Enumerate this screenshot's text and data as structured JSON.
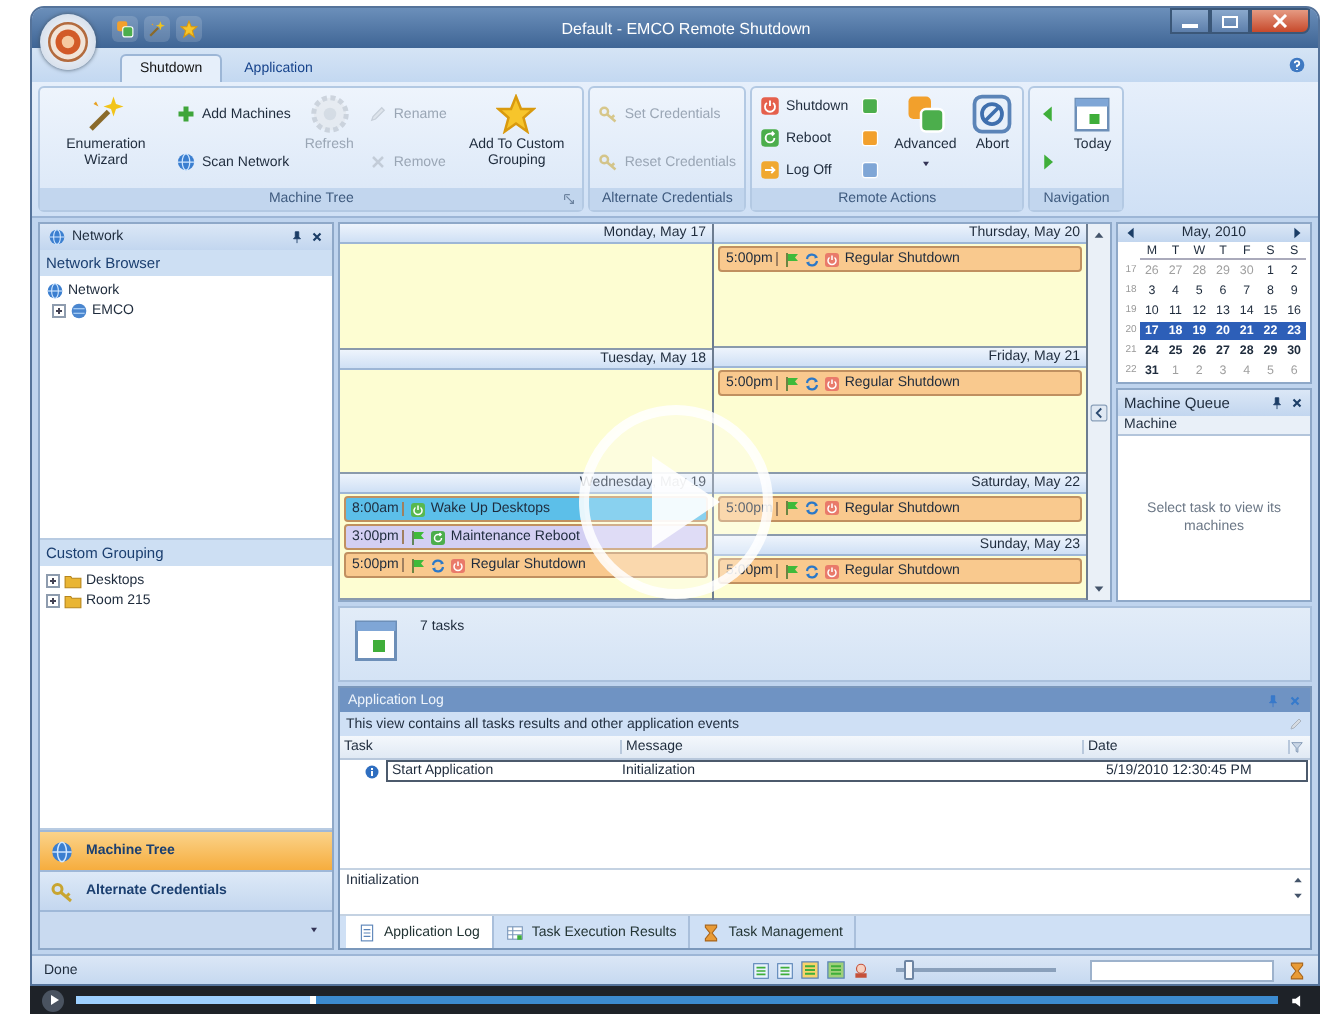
{
  "window": {
    "title": "Default - EMCO Remote Shutdown"
  },
  "ribbon": {
    "tabs": [
      {
        "label": "Shutdown",
        "selected": true
      },
      {
        "label": "Application",
        "selected": false
      }
    ],
    "groups": [
      {
        "label": "Machine Tree",
        "columns": [
          {
            "kind": "large",
            "items": [
              {
                "label": "Enumeration Wizard",
                "disabled": false
              }
            ]
          },
          {
            "kind": "stack",
            "items": [
              {
                "label": "Add Machines",
                "disabled": false
              },
              {
                "label": "Scan Network",
                "disabled": false
              }
            ]
          },
          {
            "kind": "large",
            "items": [
              {
                "label": "Refresh",
                "disabled": true
              }
            ]
          },
          {
            "kind": "stack",
            "items": [
              {
                "label": "Rename",
                "disabled": true
              },
              {
                "label": "Remove",
                "disabled": true
              }
            ]
          },
          {
            "kind": "large",
            "items": [
              {
                "label": "Add To Custom Grouping",
                "disabled": false
              }
            ]
          }
        ]
      },
      {
        "label": "Alternate Credentials",
        "columns": [
          {
            "kind": "stack",
            "items": [
              {
                "label": "Set Credentials",
                "disabled": true
              },
              {
                "label": "Reset Credentials",
                "disabled": true
              }
            ]
          }
        ]
      },
      {
        "label": "Remote Actions",
        "columns": [
          {
            "kind": "stack",
            "items": [
              {
                "label": "Shutdown",
                "disabled": false
              },
              {
                "label": "Reboot",
                "disabled": false
              },
              {
                "label": "Log Off",
                "disabled": false
              }
            ]
          },
          {
            "kind": "stack",
            "items": [
              {
                "disabled": false
              },
              {
                "disabled": false
              },
              {
                "disabled": false
              }
            ]
          },
          {
            "kind": "large",
            "items": [
              {
                "label": "Advanced",
                "disabled": false
              }
            ]
          },
          {
            "kind": "large",
            "items": [
              {
                "label": "Abort",
                "disabled": false
              }
            ]
          }
        ]
      },
      {
        "label": "Navigation",
        "columns": [
          {
            "kind": "stack",
            "items": [
              {
                "disabled": false
              },
              {
                "disabled": false
              }
            ]
          },
          {
            "kind": "large",
            "items": [
              {
                "label": "Today",
                "disabled": false
              }
            ]
          }
        ]
      }
    ]
  },
  "left_panel": {
    "title": "Network",
    "sections": [
      {
        "title": "Network Browser",
        "tree": [
          {
            "label": "Network",
            "children": [
              {
                "label": "EMCO",
                "expanded": false
              }
            ]
          }
        ]
      },
      {
        "title": "Custom Grouping",
        "tree": [
          {
            "label": "Desktops",
            "expanded": false
          },
          {
            "label": "Room 215",
            "expanded": false
          }
        ]
      }
    ],
    "nav_buttons": [
      {
        "label": "Machine Tree",
        "selected": true
      },
      {
        "label": "Alternate Credentials",
        "selected": false
      }
    ]
  },
  "calendar": {
    "columns": [
      [
        {
          "header": "Monday, May 17"
        },
        {
          "header": "Tuesday, May 18"
        },
        {
          "header": "Wednesday, May 19",
          "events": [
            {
              "time": "8:00am",
              "label": "Wake Up Desktops",
              "kind": "wake",
              "color": "#5cbfe9"
            },
            {
              "time": "3:00pm",
              "label": "Maintenance Reboot",
              "kind": "reboot",
              "color": "#d3cff3"
            },
            {
              "time": "5:00pm",
              "label": "Regular Shutdown",
              "kind": "shutdown",
              "color": "#f9c98e"
            }
          ]
        }
      ],
      [
        {
          "header": "Thursday, May 20",
          "events": [
            {
              "time": "5:00pm",
              "label": "Regular Shutdown",
              "kind": "shutdown",
              "color": "#f9c98e"
            }
          ]
        },
        {
          "header": "Friday, May 21",
          "events": [
            {
              "time": "5:00pm",
              "label": "Regular Shutdown",
              "kind": "shutdown",
              "color": "#f9c98e"
            }
          ]
        },
        {
          "header": "Saturday, May 22",
          "events": [
            {
              "time": "5:00pm",
              "label": "Regular Shutdown",
              "kind": "shutdown",
              "color": "#f9c98e"
            }
          ]
        },
        {
          "header": "Sunday, May 23",
          "events": [
            {
              "time": "5:00pm",
              "label": "Regular Shutdown",
              "kind": "shutdown",
              "color": "#f9c98e"
            }
          ]
        }
      ]
    ],
    "task_count": "7 tasks"
  },
  "mini_calendar": {
    "title": "May, 2010",
    "weekdays": [
      "M",
      "T",
      "W",
      "T",
      "F",
      "S",
      "S"
    ],
    "weeks": [
      {
        "number": "17",
        "selected": false,
        "bold": false,
        "days": [
          {
            "d": "26",
            "muted": true
          },
          {
            "d": "27",
            "muted": true
          },
          {
            "d": "28",
            "muted": true
          },
          {
            "d": "29",
            "muted": true
          },
          {
            "d": "30",
            "muted": true
          },
          {
            "d": "1",
            "muted": false
          },
          {
            "d": "2",
            "muted": false
          }
        ]
      },
      {
        "number": "18",
        "selected": false,
        "bold": false,
        "days": [
          {
            "d": "3",
            "muted": false
          },
          {
            "d": "4",
            "muted": false
          },
          {
            "d": "5",
            "muted": false
          },
          {
            "d": "6",
            "muted": false
          },
          {
            "d": "7",
            "muted": false
          },
          {
            "d": "8",
            "muted": false
          },
          {
            "d": "9",
            "muted": false
          }
        ]
      },
      {
        "number": "19",
        "selected": false,
        "bold": false,
        "days": [
          {
            "d": "10",
            "muted": false
          },
          {
            "d": "11",
            "muted": false
          },
          {
            "d": "12",
            "muted": false
          },
          {
            "d": "13",
            "muted": false
          },
          {
            "d": "14",
            "muted": false
          },
          {
            "d": "15",
            "muted": false
          },
          {
            "d": "16",
            "muted": false
          }
        ]
      },
      {
        "number": "20",
        "selected": true,
        "bold": true,
        "days": [
          {
            "d": "17",
            "muted": false
          },
          {
            "d": "18",
            "muted": false
          },
          {
            "d": "19",
            "muted": false
          },
          {
            "d": "20",
            "muted": false
          },
          {
            "d": "21",
            "muted": false
          },
          {
            "d": "22",
            "muted": false
          },
          {
            "d": "23",
            "muted": false
          }
        ]
      },
      {
        "number": "21",
        "selected": false,
        "bold": true,
        "days": [
          {
            "d": "24",
            "muted": false
          },
          {
            "d": "25",
            "muted": false
          },
          {
            "d": "26",
            "muted": false
          },
          {
            "d": "27",
            "muted": false
          },
          {
            "d": "28",
            "muted": false
          },
          {
            "d": "29",
            "muted": false
          },
          {
            "d": "30",
            "muted": false
          }
        ]
      },
      {
        "number": "22",
        "selected": false,
        "bold": true,
        "days": [
          {
            "d": "31",
            "muted": false
          },
          {
            "d": "1",
            "muted": true
          },
          {
            "d": "2",
            "muted": true
          },
          {
            "d": "3",
            "muted": true
          },
          {
            "d": "4",
            "muted": true
          },
          {
            "d": "5",
            "muted": true
          },
          {
            "d": "6",
            "muted": true
          }
        ]
      }
    ]
  },
  "machine_queue": {
    "title": "Machine Queue",
    "column": "Machine",
    "empty_text": "Select task to view its machines"
  },
  "app_log": {
    "title": "Application Log",
    "info": "This view contains all tasks results and other application events",
    "columns": [
      "Task",
      "Message",
      "Date"
    ],
    "rows": [
      {
        "cells": [
          "Start Application",
          "Initialization",
          "5/19/2010 12:30:45 PM"
        ]
      }
    ],
    "detail": "Initialization",
    "tabs": [
      {
        "label": "Application Log",
        "selected": true
      },
      {
        "label": "Task Execution Results",
        "selected": false
      },
      {
        "label": "Task Management",
        "selected": false
      }
    ]
  },
  "status_bar": {
    "text": "Done",
    "zoom": {
      "level": 0.08
    }
  },
  "player": {
    "seek": {
      "level": 0.2
    }
  }
}
